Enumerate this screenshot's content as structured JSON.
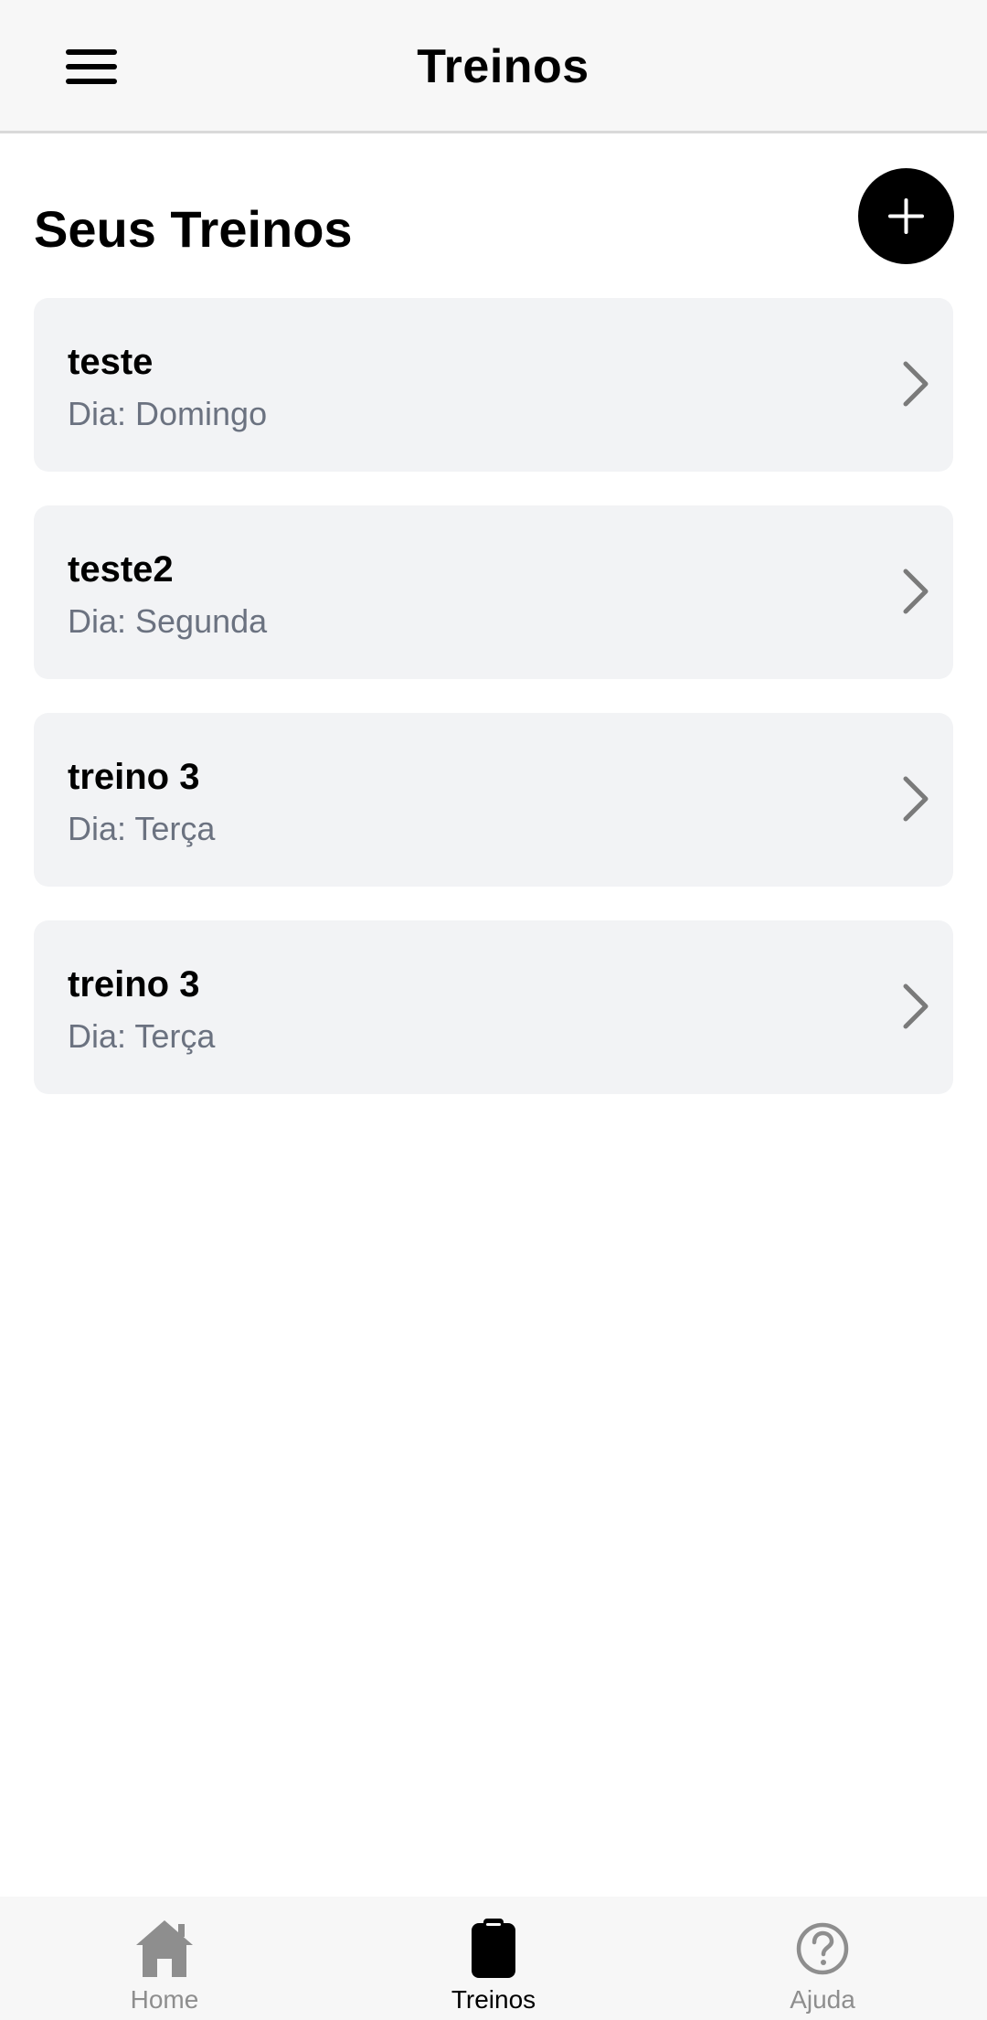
{
  "header": {
    "title": "Treinos",
    "menu_icon": "hamburger-menu-icon"
  },
  "section": {
    "title": "Seus Treinos",
    "add_icon": "plus-icon"
  },
  "workouts": [
    {
      "name": "teste",
      "day": "Dia: Domingo"
    },
    {
      "name": "teste2",
      "day": "Dia: Segunda"
    },
    {
      "name": "treino 3",
      "day": "Dia: Terça"
    },
    {
      "name": "treino 3",
      "day": "Dia: Terça"
    }
  ],
  "bottom_nav": {
    "items": [
      {
        "label": "Home",
        "icon": "home-icon",
        "active": false
      },
      {
        "label": "Treinos",
        "icon": "clipboard-icon",
        "active": true
      },
      {
        "label": "Ajuda",
        "icon": "help-circle-icon",
        "active": false
      }
    ]
  },
  "colors": {
    "header_bg": "#f7f7f7",
    "card_bg": "#f2f3f5",
    "subtitle_text": "#6b7280",
    "inactive_nav": "#8e8e8e",
    "active_nav": "#000000",
    "fab_bg": "#000000"
  }
}
